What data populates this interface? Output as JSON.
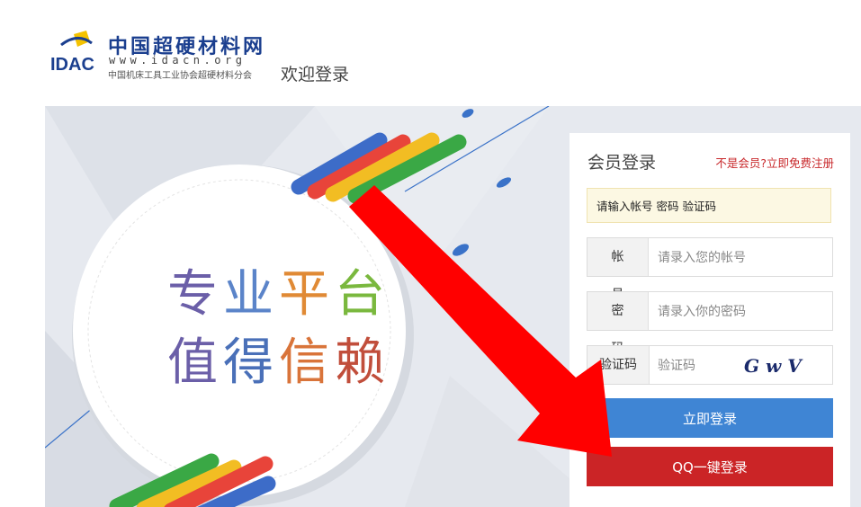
{
  "header": {
    "logo_text": "IDAC",
    "brand_name": "中国超硬材料网",
    "brand_url": "www.idacn.org",
    "org_name": "中国机床工具工业协会超硬材料分会",
    "welcome": "欢迎登录"
  },
  "banner": {
    "slogan_line1": [
      "专",
      "业",
      "平",
      "台"
    ],
    "slogan_line2": [
      "值",
      "得",
      "信",
      "赖"
    ]
  },
  "login": {
    "title": "会员登录",
    "register_link": "不是会员?立即免费注册",
    "notice": "请输入帐号 密码 验证码",
    "account_label": "帐号",
    "account_placeholder": "请录入您的帐号",
    "password_label": "密码",
    "password_placeholder": "请录入你的密码",
    "captcha_label": "验证码",
    "captcha_placeholder": "验证码",
    "captcha_text": "G w V",
    "login_button": "立即登录",
    "qq_button": "QQ一键登录"
  },
  "colors": {
    "brand_blue": "#1b3f8f",
    "link_red": "#c8282b",
    "login_blue": "#3f85d4",
    "qq_red": "#cb2426",
    "annotation_arrow": "#ff0000"
  },
  "icons": [
    "diamond-logo-icon",
    "red-arrow-annotation"
  ]
}
